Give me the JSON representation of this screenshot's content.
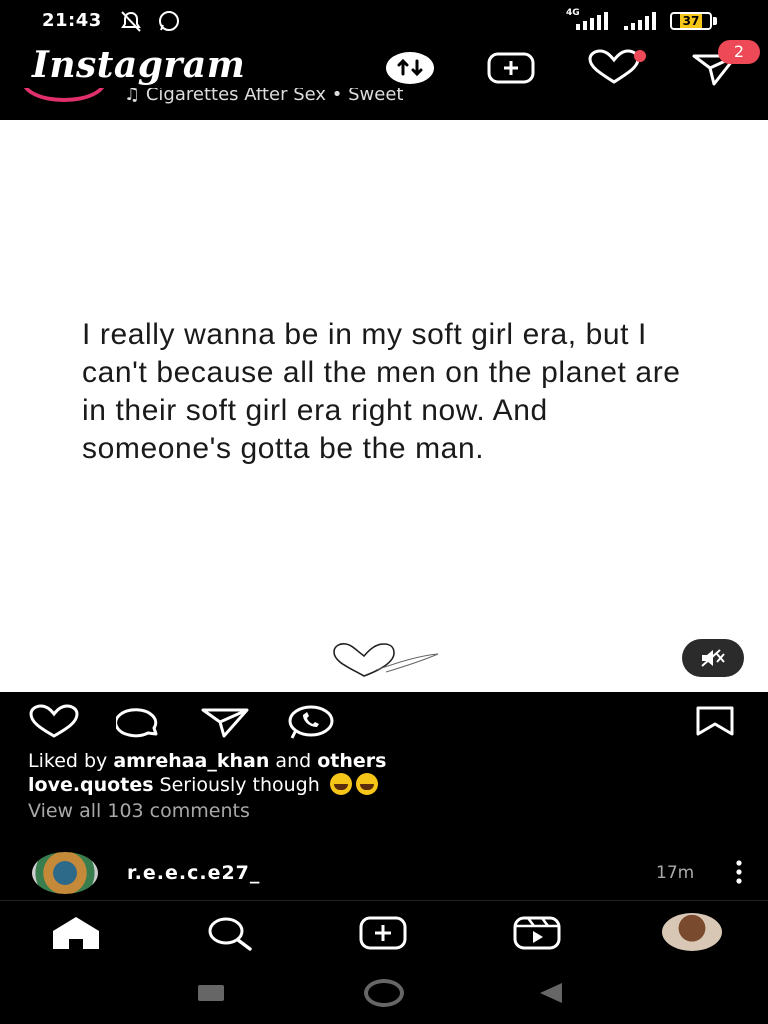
{
  "status_bar": {
    "time": "21:43",
    "network": "4G",
    "battery": "37"
  },
  "header": {
    "app_name": "Instagram",
    "notification_count": "2"
  },
  "previous_post": {
    "music": "Cigarettes After Sex • Sweet"
  },
  "post": {
    "quote": "I really wanna be in my soft girl era, but I can't because all the men on the planet are in their soft girl era right now. And someone's gotta be the man.",
    "likes_prefix": "Liked by ",
    "likes_user": "amrehaa_khan",
    "likes_and": " and ",
    "likes_others": "others",
    "caption_user": "love.quotes",
    "caption_text": " Seriously though ",
    "view_comments": "View all 103 comments"
  },
  "next_post": {
    "username": "r.e.e.c.e27_",
    "time": "17m"
  },
  "colors": {
    "background": "#000000",
    "post_bg": "#ffffff",
    "badge": "#ed4956",
    "muted_text": "#a8a8a8"
  },
  "icons": {
    "header": [
      "data-saver-icon",
      "new-post-icon",
      "heart-icon",
      "direct-message-icon"
    ],
    "actions": [
      "like-icon",
      "comment-icon",
      "share-icon",
      "whatsapp-icon",
      "save-icon"
    ],
    "nav": [
      "home-icon",
      "search-icon",
      "create-icon",
      "reels-icon",
      "profile-avatar"
    ]
  }
}
